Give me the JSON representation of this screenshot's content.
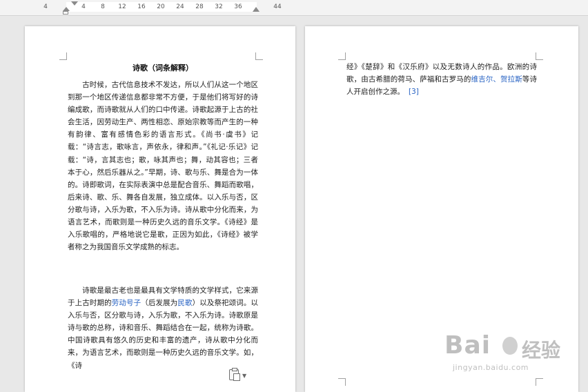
{
  "ruler": {
    "labels": [
      "4",
      "4",
      "8",
      "12",
      "16",
      "20",
      "24",
      "28",
      "32",
      "36",
      "44"
    ]
  },
  "page1": {
    "title": "诗歌（词条解释）",
    "para1": "古时候，古代信息技术不发达，所以人们从这一个地区到那一个地区传递信息都非常不方便，于是他们将写好的诗编成歌，而诗歌就从人们的口中传递。诗歌起源于上古的社会生活，因劳动生产、两性相恋、原始宗教等而产生的一种有韵律、富有感情色彩的语言形式。《尚书·虞书》记载：“诗言志，歌咏言，声依永，律和声。”《礼记·乐记》记载：“诗，言其志也；歌，咏其声也；舞，动其容也；三者本于心，然后乐器从之。”早期，诗、歌与乐、舞是合为一体的。诗即歌词，在实际表演中总是配合音乐、舞蹈而歌唱，后来诗、歌、乐、舞各自发展，独立成体。以入乐与否，区分歌与诗，入乐为歌，不入乐为诗。诗从歌中分化而来，为语言艺术，而歌则是一种历史久远的音乐文学。《诗经》是入乐歌唱的，严格地说它是歌，正因为如此，《诗经》被学者称之为我国音乐文学成熟的标志。",
    "para2_a": "诗歌是最古老也是最具有文学特质的文学样式，它来源于上古时期的",
    "para2_link1": "劳动号子",
    "para2_b": "（后发展为",
    "para2_link2": "民歌",
    "para2_c": "）以及祭祀颂词。以入乐与否，区分歌与诗，入乐为歌，不入乐为诗。诗歌原是诗与歌的总称，诗和音乐、舞蹈结合在一起，统称为诗歌。中国诗歌具有悠久的历史和丰富的遗产，诗从歌中分化而来，为语言艺术，而歌则是一种历史久远的音乐文学。如，《诗"
  },
  "page2": {
    "text_a": "经》《楚辞》和《汉乐府》以及无数诗人的作品。欧洲的诗歌，由古希腊的荷马、萨福和古罗马的",
    "link1": "维吉尔",
    "sep": "、",
    "link2": "贺拉斯",
    "text_b": "等诗人开启创作之源。",
    "citation": "[3]"
  },
  "watermark": {
    "logo": "Bai",
    "logo2": "经验",
    "url": "jingyan.baidu.com"
  },
  "colors": {
    "link": "#2762c3",
    "background": "#e8e8e8",
    "page": "#ffffff"
  }
}
